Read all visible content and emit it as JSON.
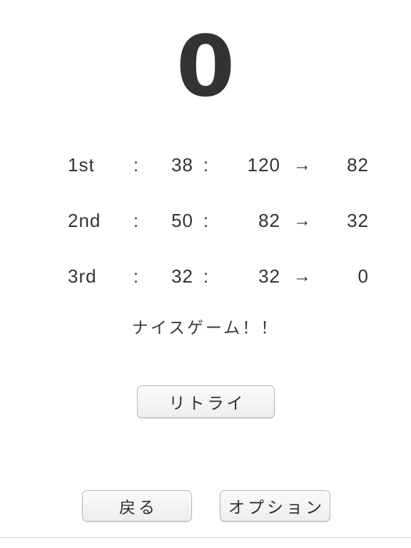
{
  "screen": {
    "name": "game-result-screen",
    "background_color": "#ffffff",
    "text_color": "#333333"
  },
  "result": {
    "final_score": "0"
  },
  "rounds": {
    "separator": ":",
    "arrow": "→",
    "items": [
      {
        "label": "1st",
        "sep1": ":",
        "throw_value": "38",
        "sep2": ":",
        "score_before": "120",
        "arrow": "→",
        "score_after": "82"
      },
      {
        "label": "2nd",
        "sep1": ":",
        "throw_value": "50",
        "sep2": ":",
        "score_before": "82",
        "arrow": "→",
        "score_after": "32"
      },
      {
        "label": "3rd",
        "sep1": ":",
        "throw_value": "32",
        "sep2": ":",
        "score_before": "32",
        "arrow": "→",
        "score_after": "0"
      }
    ]
  },
  "message": {
    "text": "ナイスゲーム！！"
  },
  "buttons": {
    "retry": "リトライ",
    "back": "戻る",
    "options": "オプション",
    "face_color": "#f4f4f4",
    "border_color": "#b9b9b9"
  },
  "divider": {
    "color": "#d5d5d5"
  }
}
